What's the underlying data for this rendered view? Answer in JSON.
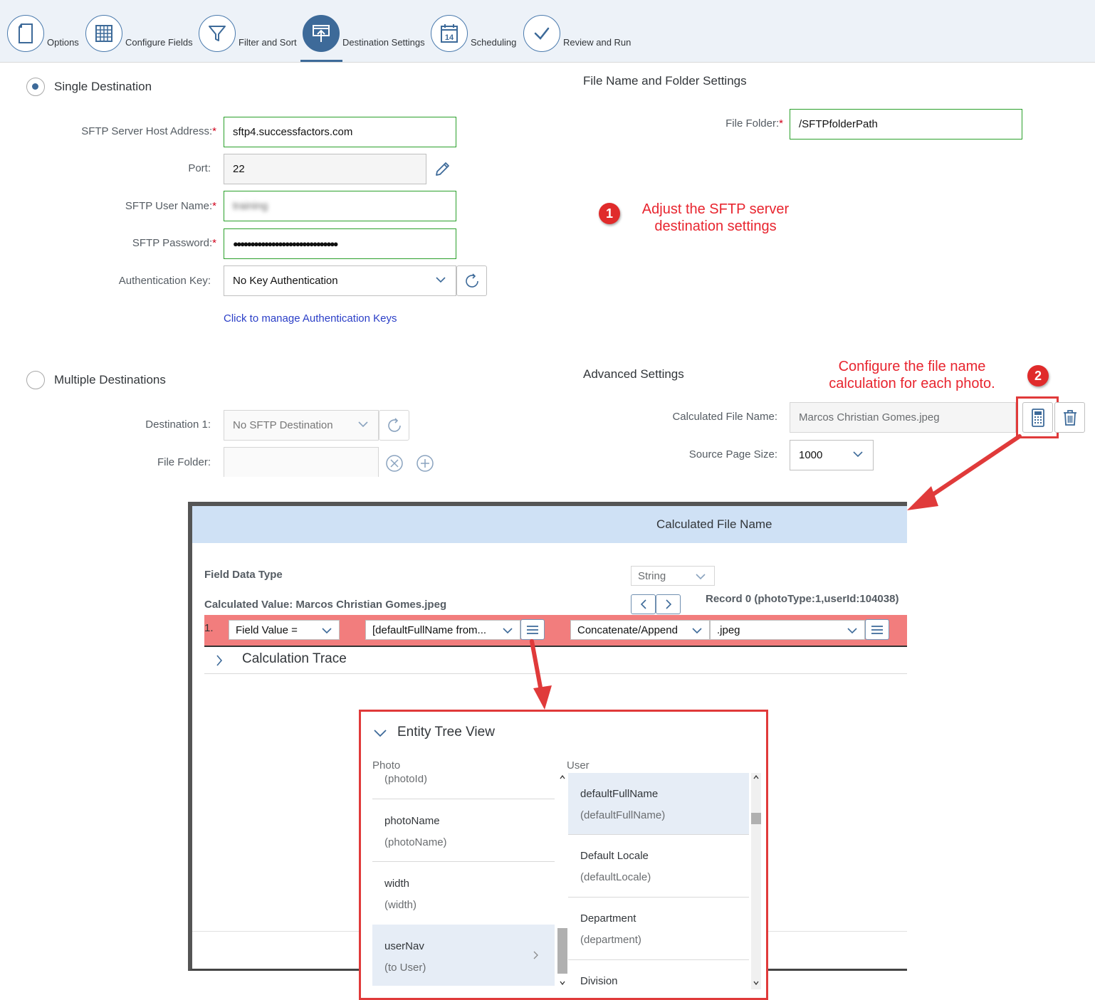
{
  "wizard": {
    "steps": [
      {
        "label": "Options",
        "icon": "document-icon"
      },
      {
        "label": "Configure Fields",
        "icon": "grid-icon"
      },
      {
        "label": "Filter and Sort",
        "icon": "funnel-icon"
      },
      {
        "label": "Destination Settings",
        "icon": "upload-board-icon"
      },
      {
        "label": "Scheduling",
        "icon": "calendar-icon"
      },
      {
        "label": "Review and Run",
        "icon": "check-icon"
      }
    ],
    "calendar_day": "14"
  },
  "single": {
    "label": "Single Destination",
    "host_label": "SFTP Server Host Address:",
    "host_value": "sftp4.successfactors.com",
    "port_label": "Port:",
    "port_value": "22",
    "user_label": "SFTP User Name:",
    "user_value": "training",
    "password_label": "SFTP Password:",
    "password_value": "●●●●●●●●●●●●●●●●●●●●●●●●●●●●●●",
    "auth_label": "Authentication Key:",
    "auth_value": "No Key Authentication",
    "auth_link": "Click to manage Authentication Keys"
  },
  "file_settings": {
    "title": "File Name and Folder Settings",
    "folder_label": "File Folder:",
    "folder_value": "/SFTPfolderPath"
  },
  "annotations": {
    "n1": "1",
    "text1_l1": "Adjust the SFTP server",
    "text1_l2": "destination settings",
    "n2": "2",
    "text2_l1": "Configure the file name",
    "text2_l2": "calculation for each photo."
  },
  "multiple": {
    "label": "Multiple Destinations",
    "dest_label": "Destination 1:",
    "dest_value": "No SFTP Destination",
    "folder_label": "File Folder:"
  },
  "advanced": {
    "title": "Advanced Settings",
    "calc_label": "Calculated File Name:",
    "calc_value": "Marcos Christian Gomes.jpeg",
    "page_label": "Source Page Size:",
    "page_value": "1000"
  },
  "dialog": {
    "title": "Calculated File Name",
    "type_label": "Field Data Type",
    "type_value": "String",
    "calc_value_label": "Calculated Value: Marcos Christian Gomes.jpeg",
    "record": "Record 0 (photoType:1,userId:104038)",
    "row_num": "1.",
    "op1": "Field Value =",
    "field": "[defaultFullName from...",
    "op2": "Concatenate/Append",
    "suffix": ".jpeg",
    "trace": "Calculation Trace"
  },
  "tree": {
    "title": "Entity Tree View",
    "left_header": "Photo",
    "right_header": "User",
    "left_items": [
      {
        "name": "",
        "sub": "(photoId)"
      },
      {
        "name": "photoName",
        "sub": "(photoName)"
      },
      {
        "name": "width",
        "sub": "(width)"
      },
      {
        "name": "userNav",
        "sub": "(to User)"
      }
    ],
    "right_items": [
      {
        "name": "defaultFullName",
        "sub": "(defaultFullName)"
      },
      {
        "name": "Default Locale",
        "sub": "(defaultLocale)"
      },
      {
        "name": "Department",
        "sub": "(department)"
      },
      {
        "name": "Division",
        "sub": ""
      }
    ]
  }
}
